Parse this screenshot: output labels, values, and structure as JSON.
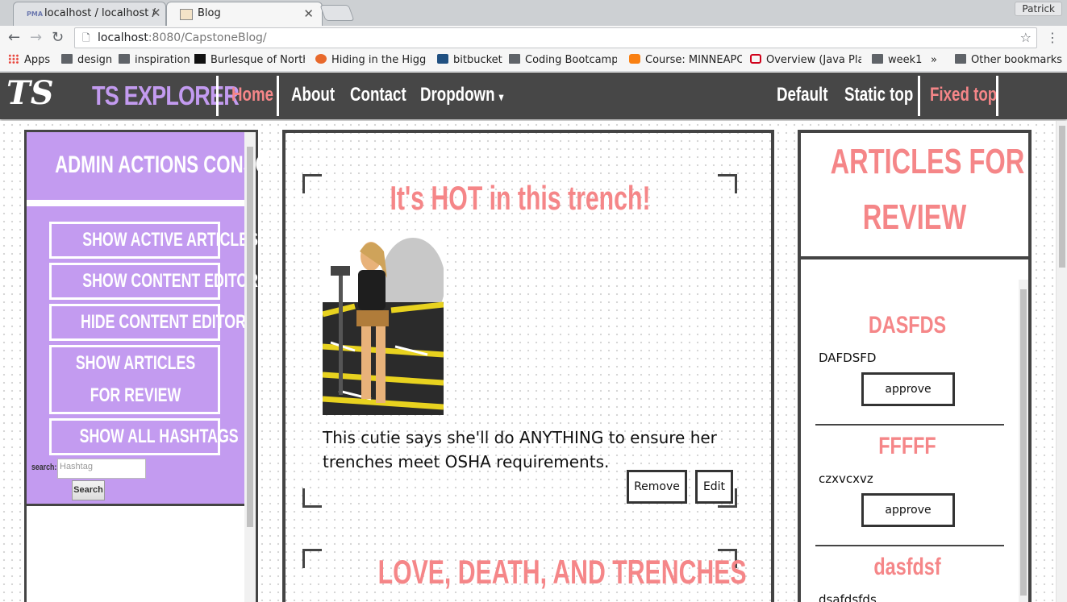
{
  "browser": {
    "tabs": [
      {
        "title": "localhost / localhost /",
        "favicon": "phpmyadmin-icon"
      },
      {
        "title": "Blog",
        "favicon": "blog-icon"
      }
    ],
    "profile": "Patrick",
    "url_host": "localhost",
    "url_rest": ":8080/CapstoneBlog/",
    "bookmarks": [
      "Apps",
      "design",
      "inspiration",
      "Burlesque of North",
      "Hiding in the Higgs",
      "bitbucket",
      "Coding Bootcamp: I",
      "Course: MINNEAPO",
      "Overview (Java Pla",
      "week1"
    ],
    "bookmarks_overflow": "»",
    "other_bookmarks": "Other bookmarks"
  },
  "site": {
    "logo": "TS",
    "brand": "TS EXPLORER",
    "nav": [
      "Home",
      "About",
      "Contact",
      "Dropdown"
    ],
    "nav_right": [
      "Default",
      "Static top",
      "Fixed top"
    ],
    "colors": {
      "accent": "#c39bf0",
      "pink": "#f58688",
      "header": "#474747"
    }
  },
  "admin": {
    "title": "ADMIN ACTIONS CONSOLE",
    "buttons": [
      "SHOW ACTIVE ARTICLES",
      "SHOW CONTENT EDITOR",
      "HIDE CONTENT EDITOR",
      "SHOW ARTICLES FOR REVIEW",
      "SHOW ALL HASHTAGS"
    ],
    "search_label": "search:",
    "search_placeholder": "Hashtag",
    "search_button": "Search"
  },
  "articles": [
    {
      "title": "It's HOT in this trench!",
      "content": "This cutie says she'll do ANYTHING to ensure her trenches meet OSHA requirements.",
      "remove": "Remove",
      "edit": "Edit"
    },
    {
      "title": "LOVE, DEATH, AND TRENCHES"
    }
  ],
  "review": {
    "title_line1": "ARTICLES FOR",
    "title_line2": "REVIEW",
    "items": [
      {
        "title": "DASFDS",
        "text": "DAFDSFD",
        "action": "approve"
      },
      {
        "title": "FFFFF",
        "text": "czxvcxvz",
        "action": "approve"
      },
      {
        "title": "dasfdsf",
        "text": "dsafdsfds"
      }
    ]
  }
}
